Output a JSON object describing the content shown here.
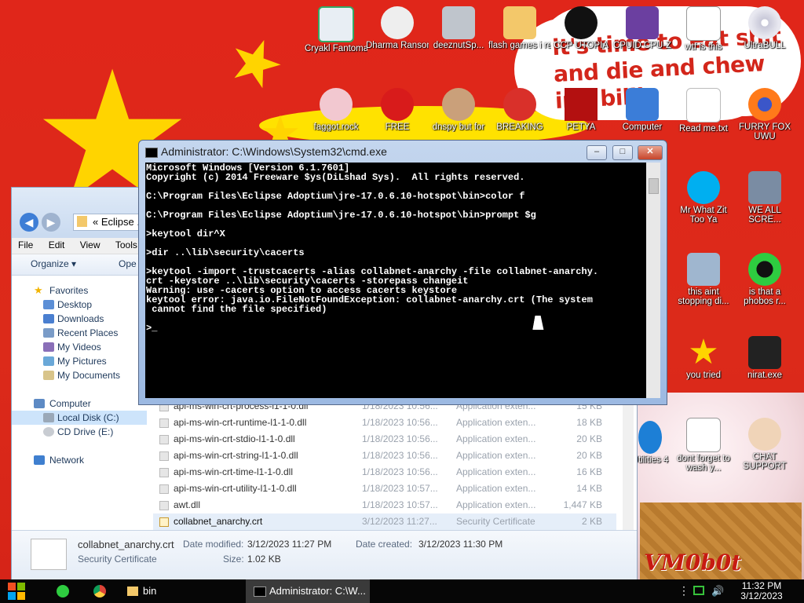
{
  "wallpaper": {
    "cloud_text": "it's time to eat shit and die and chew bubble gum, and i'm all out of gum",
    "cloud_text_visible": "it's time to eat shit and die and chew ing billin",
    "watermark": "VM0b0t"
  },
  "desktop_icons": [
    {
      "label": "Cryakl Fantomas ...",
      "icon": "program-icon"
    },
    {
      "label": "Dharma Ransomw...",
      "icon": "skull-icon"
    },
    {
      "label": "deeznutSp...",
      "icon": "windows-icon"
    },
    {
      "label": "flash games i remember",
      "icon": "folder-icon"
    },
    {
      "label": "CCP UTOPIA",
      "icon": "ccp-icon"
    },
    {
      "label": "CPUID CPU-Z",
      "icon": "cpuz-icon"
    },
    {
      "label": "wtf is this",
      "icon": "document-icon"
    },
    {
      "label": "UltraBULL",
      "icon": "cd-icon"
    },
    {
      "label": "faggot.rock",
      "icon": "chef-icon"
    },
    {
      "label": "FREE",
      "icon": "apple-icon"
    },
    {
      "label": "dnspy but for",
      "icon": "portrait-icon"
    },
    {
      "label": "BREAKING",
      "icon": "angry-bird-icon"
    },
    {
      "label": "PETYA",
      "icon": "petya-icon"
    },
    {
      "label": "Computer",
      "icon": "computer-icon"
    },
    {
      "label": "Read me.txt",
      "icon": "text-file-icon"
    },
    {
      "label": "FURRY FOX UWU",
      "icon": "firefox-icon"
    },
    {
      "label": "Mr What Zit Too Ya",
      "icon": "skype-icon"
    },
    {
      "label": "WE ALL SCRE...",
      "icon": "computer-virus-icon"
    },
    {
      "label": "this aint stopping di...",
      "icon": "monitor-icon"
    },
    {
      "label": "is that a phobos r...",
      "icon": "phobos-icon"
    },
    {
      "label": "you tried",
      "icon": "star-icon"
    },
    {
      "label": "nirat.exe",
      "icon": "skull-icon"
    },
    {
      "label": "Utilities 4",
      "icon": "utilities-icon"
    },
    {
      "label": "dont forget to wash y...",
      "icon": "document-icon"
    },
    {
      "label": "CHAT SUPPORT",
      "icon": "support-icon"
    }
  ],
  "explorer": {
    "address": "« Eclipse ...",
    "menu": [
      "File",
      "Edit",
      "View",
      "Tools"
    ],
    "toolbar": {
      "organize": "Organize ▾",
      "open": "Ope"
    },
    "nav": {
      "favorites": "Favorites",
      "desktop": "Desktop",
      "downloads": "Downloads",
      "recent": "Recent Places",
      "videos": "My Videos",
      "pictures": "My Pictures",
      "documents": "My Documents",
      "computer": "Computer",
      "local_disk": "Local Disk (C:)",
      "cd_drive": "CD Drive (E:)",
      "network": "Network"
    },
    "files": [
      {
        "name": "api-ms-win-crt-process-l1-1-0.dll",
        "date": "1/18/2023 10:56...",
        "type": "Application exten...",
        "size": "15 KB"
      },
      {
        "name": "api-ms-win-crt-runtime-l1-1-0.dll",
        "date": "1/18/2023 10:56...",
        "type": "Application exten...",
        "size": "18 KB"
      },
      {
        "name": "api-ms-win-crt-stdio-l1-1-0.dll",
        "date": "1/18/2023 10:56...",
        "type": "Application exten...",
        "size": "20 KB"
      },
      {
        "name": "api-ms-win-crt-string-l1-1-0.dll",
        "date": "1/18/2023 10:56...",
        "type": "Application exten...",
        "size": "20 KB"
      },
      {
        "name": "api-ms-win-crt-time-l1-1-0.dll",
        "date": "1/18/2023 10:56...",
        "type": "Application exten...",
        "size": "16 KB"
      },
      {
        "name": "api-ms-win-crt-utility-l1-1-0.dll",
        "date": "1/18/2023 10:57...",
        "type": "Application exten...",
        "size": "14 KB"
      },
      {
        "name": "awt.dll",
        "date": "1/18/2023 10:57...",
        "type": "Application exten...",
        "size": "1,447 KB"
      },
      {
        "name": "collabnet_anarchy.crt",
        "date": "3/12/2023 11:27...",
        "type": "Security Certificate",
        "size": "2 KB"
      }
    ],
    "details": {
      "filename": "collabnet_anarchy.crt",
      "filetype": "Security Certificate",
      "modified_label": "Date modified:",
      "modified": "3/12/2023 11:27 PM",
      "created_label": "Date created:",
      "created": "3/12/2023 11:30 PM",
      "size_label": "Size:",
      "size": "1.02 KB"
    }
  },
  "cmd": {
    "title": "Administrator: C:\\Windows\\System32\\cmd.exe",
    "lines": [
      "Microsoft Windows [Version 6.1.7601]",
      "Copyright (c) 2014 Freeware $ys(DiLshad Sys).  All rights reserved.",
      "",
      "C:\\Program Files\\Eclipse Adoptium\\jre-17.0.6.10-hotspot\\bin>color f",
      "",
      "C:\\Program Files\\Eclipse Adoptium\\jre-17.0.6.10-hotspot\\bin>prompt $g",
      "",
      ">keytool dir^X",
      "",
      ">dir ..\\lib\\security\\cacerts",
      "",
      ">keytool -import -trustcacerts -alias collabnet-anarchy -file collabnet-anarchy.",
      "crt -keystore ..\\lib\\security\\cacerts -storepass changeit",
      "Warning: use -cacerts option to access cacerts keystore",
      "keytool error: java.io.FileNotFoundException: collabnet-anarchy.crt (The system",
      " cannot find the file specified)",
      "",
      ">_"
    ]
  },
  "taskbar": {
    "items": [
      {
        "label": "bin",
        "icon": "folder-icon"
      },
      {
        "label": "Administrator: C:\\W...",
        "icon": "cmd-icon"
      }
    ],
    "time": "11:32 PM",
    "date": "3/12/2023"
  }
}
